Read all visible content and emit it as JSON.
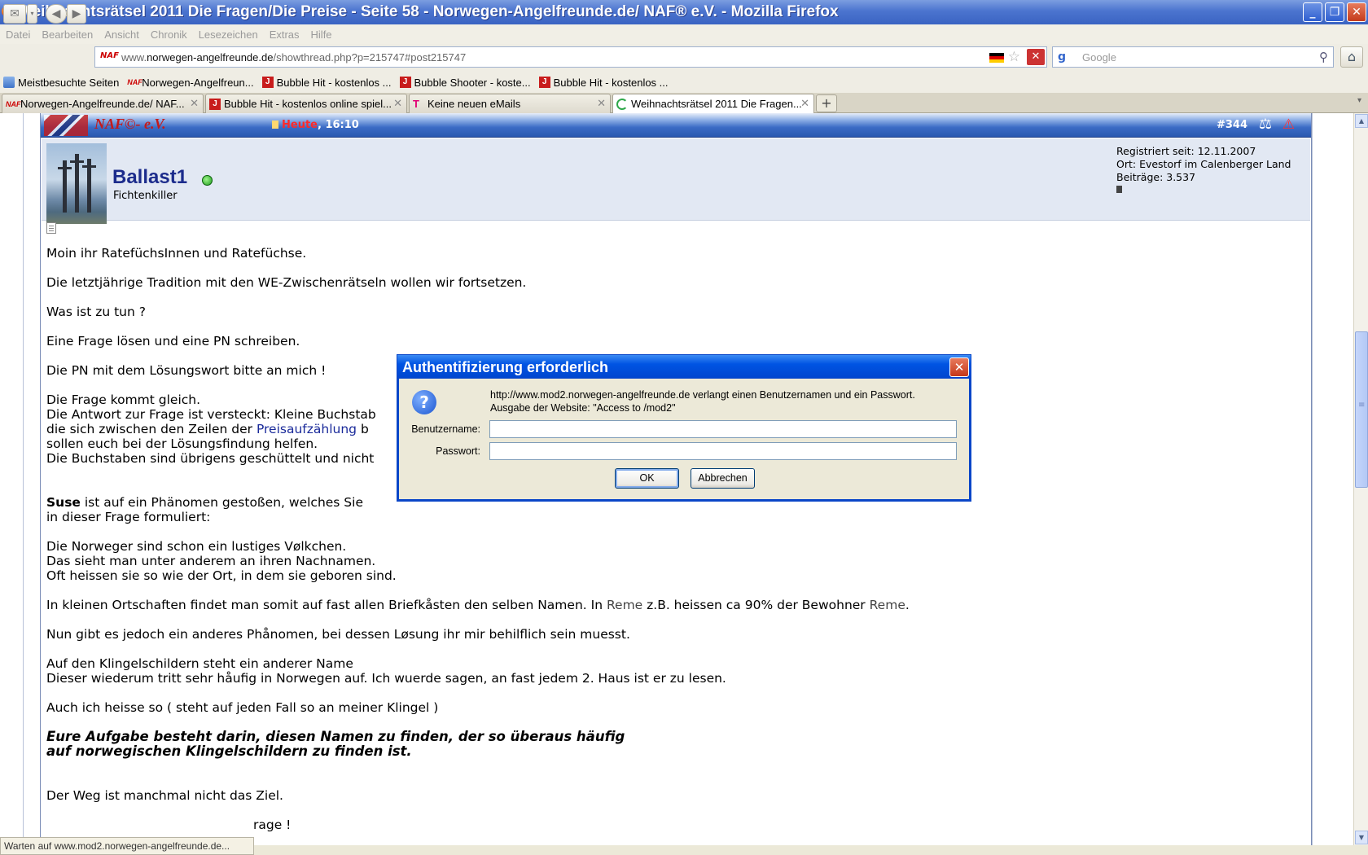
{
  "window": {
    "title": "Weihnachtsrätsel 2011 Die Fragen/Die Preise - Seite 58 - Norwegen-Angelfreunde.de/ NAF® e.V. - Mozilla Firefox",
    "minimize": "_",
    "restore": "❐",
    "close": "✕"
  },
  "menu": [
    "Datei",
    "Bearbeiten",
    "Ansicht",
    "Chronik",
    "Lesezeichen",
    "Extras",
    "Hilfe"
  ],
  "nav": {
    "url_prefix": "www.",
    "url_domain": "norwegen-angelfreunde.de",
    "url_path": "/showthread.php?p=215747#post215747",
    "site_icon": "NAF",
    "search_placeholder": "Google",
    "search_brand": "g"
  },
  "bookmarks": [
    {
      "label": "Meistbesuchte Seiten",
      "icon": "bookmark-icon"
    },
    {
      "label": "Norwegen-Angelfreun...",
      "icon": "naf-icon"
    },
    {
      "label": "Bubble Hit - kostenlos ...",
      "icon": "game-icon"
    },
    {
      "label": "Bubble Shooter - koste...",
      "icon": "game-icon"
    },
    {
      "label": "Bubble Hit - kostenlos ...",
      "icon": "game-icon"
    }
  ],
  "tabs": [
    {
      "label": "Norwegen-Angelfreunde.de/ NAF...",
      "icon": "naf"
    },
    {
      "label": "Bubble Hit - kostenlos online spiel...",
      "icon": "game"
    },
    {
      "label": "Keine neuen eMails",
      "icon": "telekom"
    },
    {
      "label": "Weihnachtsrätsel 2011 Die Fragen...",
      "icon": "loading",
      "active": true
    }
  ],
  "post": {
    "logo": "NAF©- e.V.",
    "date_today": "Heute",
    "date_time": ", 16:10",
    "number": "#344",
    "username": "Ballast1",
    "user_title": "Fichtenkiller",
    "registered": "Registriert seit: 12.11.2007",
    "location": "Ort: Evestorf im Calenberger Land",
    "posts": "Beiträge: 3.537",
    "lines": {
      "l1": "Moin ihr RatefüchsInnen und Ratefüchse.",
      "l2": "Die letztjährige Tradition mit den WE-Zwischenrätseln wollen wir fortsetzen.",
      "l3": "Was ist zu tun ?",
      "l4": "Eine Frage lösen und eine PN schreiben.",
      "l5": "Die PN mit dem Lösungswort bitte an mich !",
      "l6": "Die Frage kommt gleich.",
      "l7": "Die Antwort zur Frage ist versteckt: Kleine Buchstab",
      "l8a": "die sich zwischen den Zeilen der ",
      "l8link": "Preisaufzählung",
      "l8b": " b",
      "l9": "sollen euch bei der Lösungsfindung helfen.",
      "l10": "Die Buchstaben sind übrigens geschüttelt und nicht",
      "l11a": "Suse",
      "l11b": " ist auf ein Phänomen gestoßen, welches Sie",
      "l12": "in dieser Frage formuliert:",
      "l13": "Die Norweger sind schon ein lustiges Vølkchen.",
      "l14": "Das sieht man unter anderem an ihren Nachnamen.",
      "l15": "Oft heissen sie so wie der Ort, in dem sie geboren sind.",
      "l16a": "In kleinen Ortschaften findet man somit auf fast allen Briefkåsten den selben Namen. In ",
      "l16reme1": "Reme",
      "l16b": " z.B. heissen ca 90% der Bewohner ",
      "l16reme2": "Reme",
      "l16c": ".",
      "l17": "Nun gibt es jedoch ein anderes Phånomen, bei dessen Løsung ihr mir behilflich sein muesst.",
      "l18": "Auf den Klingelschildern steht ein anderer Name",
      "l19": "Dieser wiederum tritt sehr håufig in Norwegen auf. Ich wuerde sagen, an fast jedem 2. Haus ist er zu lesen.",
      "l20": "Auch ich heisse so ( steht auf jeden Fall so an meiner Klingel )",
      "l21": "Eure Aufgabe besteht darin, diesen Namen zu finden, der so überaus häufig",
      "l22": "auf norwegischen Klingelschildern zu finden ist.",
      "l23": "Der Weg ist manchmal nicht das Ziel.",
      "l24": "rage !"
    }
  },
  "dialog": {
    "title": "Authentifizierung erforderlich",
    "close": "✕",
    "message1": "http://www.mod2.norwegen-angelfreunde.de verlangt einen Benutzernamen und ein Passwort.",
    "message2": "Ausgabe der Website: \"Access to /mod2\"",
    "username_label": "Benutzername:",
    "password_label": "Passwort:",
    "username_value": "",
    "password_value": "",
    "ok": "OK",
    "cancel": "Abbrechen"
  },
  "status": "Warten auf www.mod2.norwegen-angelfreunde.de..."
}
